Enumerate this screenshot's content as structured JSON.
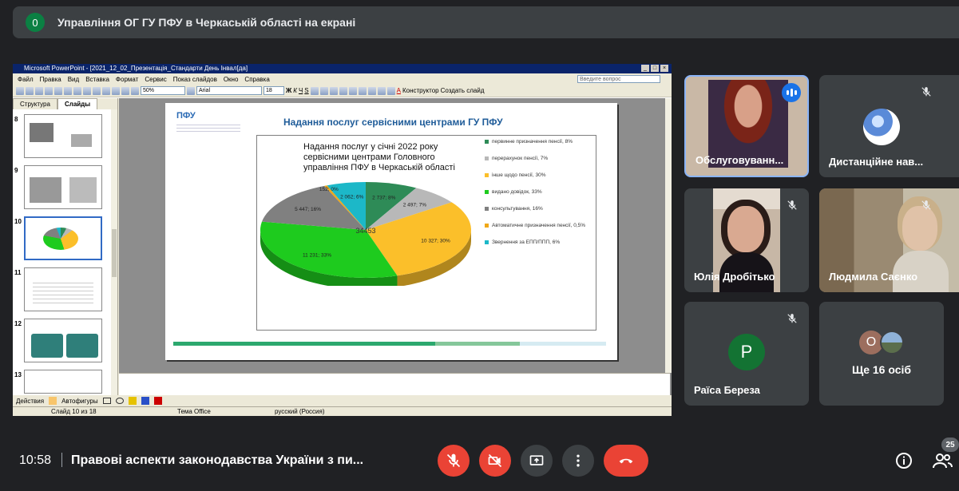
{
  "banner": {
    "badge": "0",
    "text": "Управління ОГ ГУ ПФУ в Черкаській області на екрані"
  },
  "ppt": {
    "window_title": "Microsoft PowerPoint - [2021_12_02_Презентація_Стандарти День Інвал[да]",
    "menu": [
      "Файл",
      "Правка",
      "Вид",
      "Вставка",
      "Формат",
      "Сервис",
      "Показ слайдов",
      "Окно",
      "Справка"
    ],
    "ask_placeholder": "Введите вопрос",
    "zoom": "50%",
    "font": "Arial",
    "font_size": "18",
    "designer_button": "Конструктор",
    "new_slide_button": "Создать слайд",
    "pane_tabs": [
      "Структура",
      "Слайды"
    ],
    "slide_numbers": [
      "8",
      "9",
      "10",
      "11",
      "12",
      "13"
    ],
    "draw_bar": [
      "Действия",
      "Автофигуры"
    ],
    "status": {
      "slide": "Слайд 10 из 18",
      "theme": "Тема Office",
      "lang": "русский (Россия)"
    }
  },
  "slide": {
    "logo": "ПФУ",
    "heading": "Надання послуг сервісними центрами ГУ ПФУ"
  },
  "chart_data": {
    "type": "pie",
    "title": "Надання послуг у січні 2022 року сервісними центрами Головного управління ПФУ в Черкаській області",
    "total_label": "34453",
    "slices": [
      {
        "name": "первинне призначення пенсії, 8%",
        "value": 2737,
        "label": "2 737; 8%",
        "color": "#2e8b57"
      },
      {
        "name": "перерахунок пенсії, 7%",
        "value": 2497,
        "label": "2 497; 7%",
        "color": "#b8b8b8"
      },
      {
        "name": "інше щодо пенсії, 30%",
        "value": 10327,
        "label": "10 327; 30%",
        "color": "#fbbf2a"
      },
      {
        "name": "видано довідок, 33%",
        "value": 11231,
        "label": "11 231; 33%",
        "color": "#1ecb1e"
      },
      {
        "name": "консультування, 16%",
        "value": 5447,
        "label": "5 447; 16%",
        "color": "#808080"
      },
      {
        "name": "Автоматичне призначення пенсії, 0,5%",
        "value": 152,
        "label": "152; 0%",
        "color": "#f0a818"
      },
      {
        "name": "Звернення за ЕПП/ППП, 6%",
        "value": 2062,
        "label": "2 062; 6%",
        "color": "#1cb8c8"
      }
    ]
  },
  "participants": [
    {
      "name": "Обслуговуванн...",
      "speaking": true
    },
    {
      "name": "Дистанційне нав...",
      "muted": true
    },
    {
      "name": "Юлія Дробітько",
      "muted": true
    },
    {
      "name": "Людмила Саєнко",
      "muted": true
    },
    {
      "name": "Раїса Береза",
      "initial": "Р",
      "muted": true
    },
    {
      "name": "Ще 16 осіб",
      "initial": "О"
    }
  ],
  "bottom": {
    "time": "10:58",
    "meeting_title": "Правові аспекти законодавства України з пи...",
    "people_count": "25"
  }
}
